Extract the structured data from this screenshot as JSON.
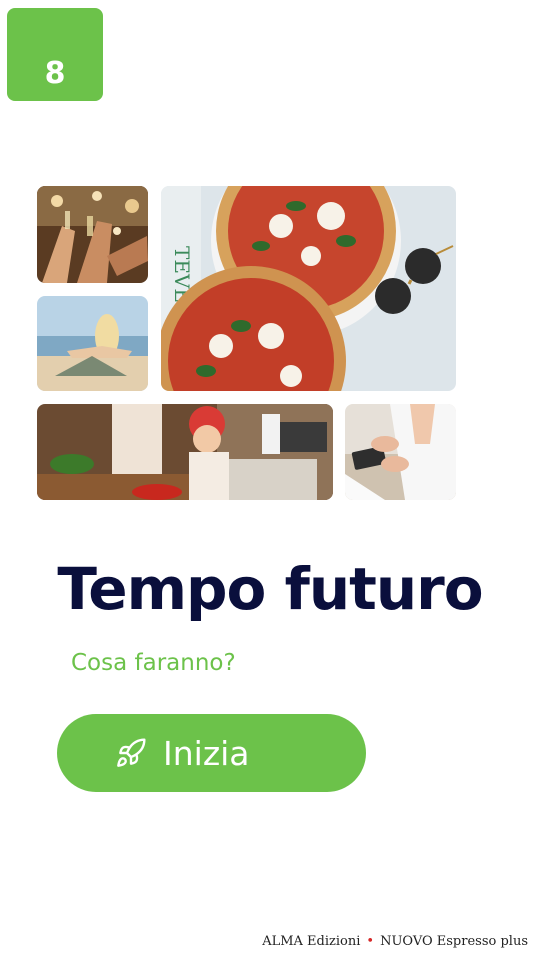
{
  "unit": {
    "number": "8"
  },
  "main": {
    "title": "Tempo futuro",
    "subtitle": "Cosa faranno?",
    "start_button_label": "Inizia",
    "start_button_icon": "rocket-icon"
  },
  "footer": {
    "publisher": "ALMA Edizioni",
    "separator": "•",
    "course": "NUOVO Espresso plus"
  },
  "colors": {
    "accent_green": "#6cc24a",
    "title_navy": "#0a0f3c",
    "separator_red": "#d62828"
  }
}
